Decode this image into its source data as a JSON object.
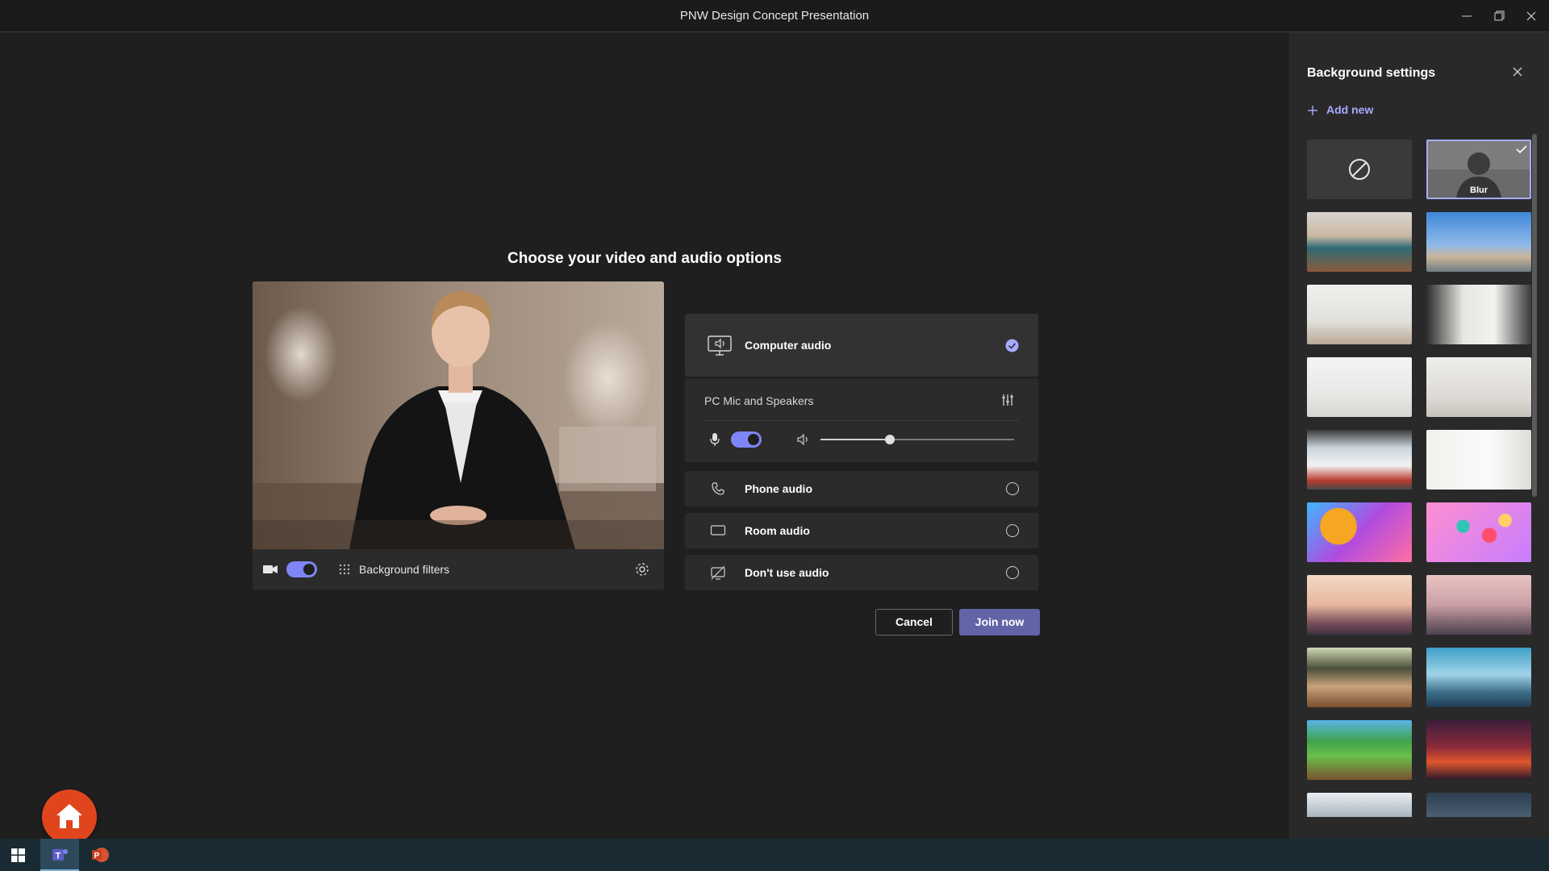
{
  "window": {
    "title": "PNW Design Concept Presentation",
    "minimize_icon": "minimize-icon",
    "restore_icon": "restore-icon",
    "close_icon": "close-icon"
  },
  "main": {
    "heading": "Choose your video and audio options",
    "video": {
      "camera_toggle_on": true,
      "background_filters_label": "Background filters"
    },
    "audio": {
      "computer_audio": {
        "label": "Computer audio",
        "selected": true
      },
      "pc_mic_label": "PC Mic and Speakers",
      "mic_toggle_on": true,
      "speaker_volume": 0.36,
      "options": [
        {
          "label": "Phone audio",
          "selected": false
        },
        {
          "label": "Room audio",
          "selected": false
        },
        {
          "label": "Don't use audio",
          "selected": false
        }
      ]
    },
    "cancel_label": "Cancel",
    "join_label": "Join now"
  },
  "background_panel": {
    "title": "Background settings",
    "add_new_label": "Add new",
    "none_icon": "no-background-icon",
    "blur_label": "Blur",
    "selected": "blur"
  },
  "taskbar": {
    "apps": [
      "windows-start-icon",
      "teams-icon",
      "powerpoint-icon"
    ]
  },
  "colors": {
    "accent": "#6264a7",
    "accent_light": "#7f85f5",
    "link": "#a7abff",
    "home_button": "#e0451e"
  }
}
